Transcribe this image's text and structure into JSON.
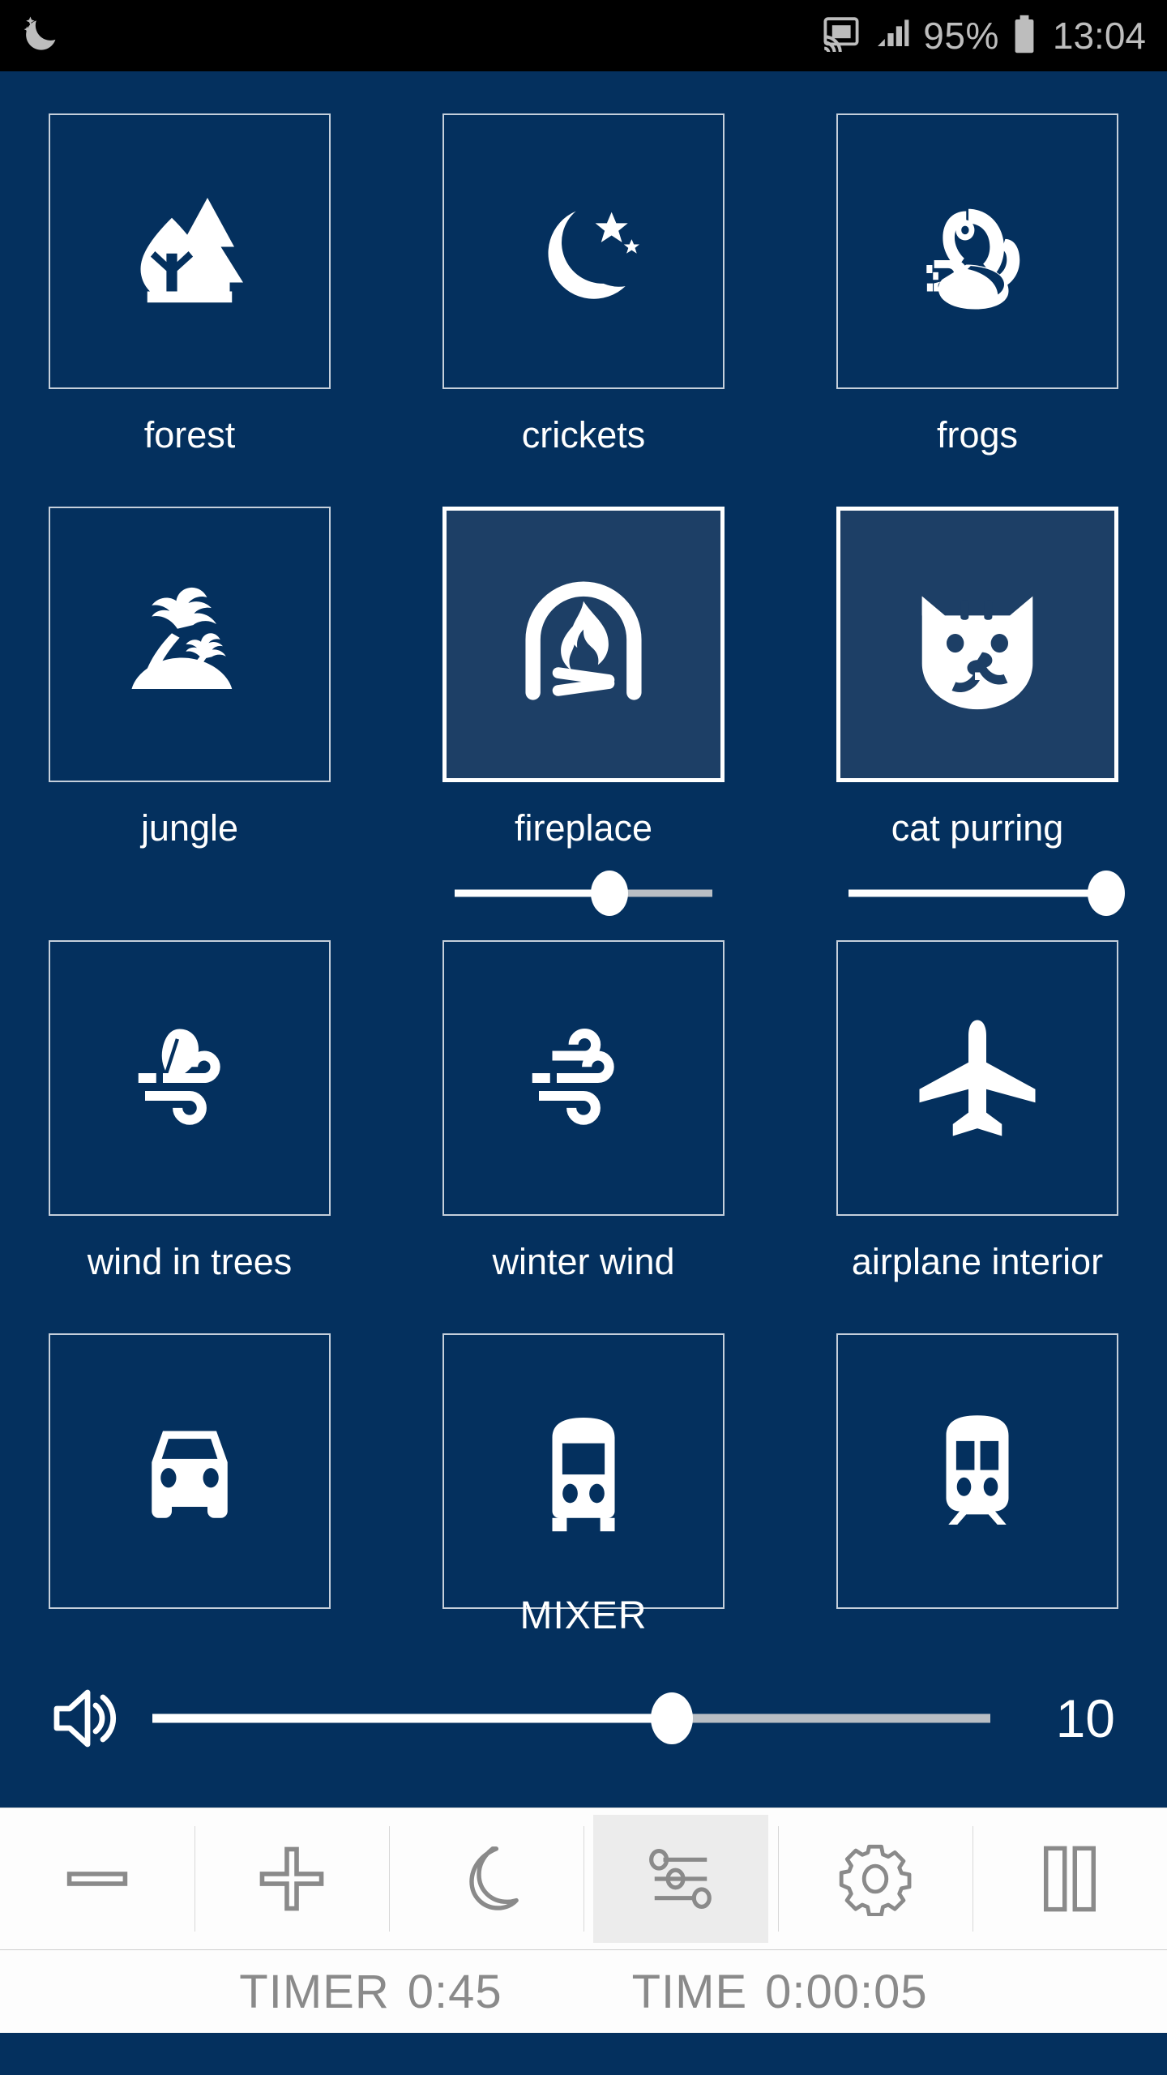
{
  "status_bar": {
    "dnd_icon": "crescent-moon-stars-icon",
    "cast_icon": "cast-screen-icon",
    "signal_icon": "signal-bars-icon",
    "battery_percent": "95%",
    "battery_icon": "battery-icon",
    "clock": "13:04"
  },
  "sounds": {
    "rows": [
      [
        {
          "label": "forest",
          "icon": "forest-trees-icon",
          "active": false,
          "volume": null
        },
        {
          "label": "crickets",
          "icon": "moon-stars-icon",
          "active": false,
          "volume": null
        },
        {
          "label": "frogs",
          "icon": "frog-icon",
          "active": false,
          "volume": null
        }
      ],
      [
        {
          "label": "jungle",
          "icon": "palm-island-icon",
          "active": false,
          "volume": null
        },
        {
          "label": "fireplace",
          "icon": "fireplace-icon",
          "active": true,
          "volume": 60
        },
        {
          "label": "cat purring",
          "icon": "cat-face-icon",
          "active": true,
          "volume": 100
        }
      ],
      [
        {
          "label": "wind in trees",
          "icon": "wind-leaf-icon",
          "active": false,
          "volume": null
        },
        {
          "label": "winter wind",
          "icon": "wind-icon",
          "active": false,
          "volume": null
        },
        {
          "label": "airplane interior",
          "icon": "airplane-icon",
          "active": false,
          "volume": null
        }
      ],
      [
        {
          "label": "",
          "icon": "car-icon",
          "active": false,
          "volume": null
        },
        {
          "label": "",
          "icon": "bus-icon",
          "active": false,
          "volume": null
        },
        {
          "label": "",
          "icon": "train-icon",
          "active": false,
          "volume": null
        }
      ]
    ]
  },
  "mixer": {
    "title": "MIXER",
    "master_volume_icon": "speaker-volume-icon",
    "master_volume_percent": 62,
    "master_volume_value": "10"
  },
  "toolbar": {
    "buttons": [
      {
        "name": "minus-button",
        "icon": "minus-icon",
        "active": false
      },
      {
        "name": "plus-button",
        "icon": "plus-icon",
        "active": false
      },
      {
        "name": "night-button",
        "icon": "crescent-moon-icon",
        "active": false
      },
      {
        "name": "mixer-button",
        "icon": "sliders-icon",
        "active": true
      },
      {
        "name": "settings-button",
        "icon": "gear-icon",
        "active": false
      },
      {
        "name": "pause-button",
        "icon": "pause-icon",
        "active": false
      }
    ]
  },
  "footer": {
    "timer_label": "TIMER",
    "timer_value": "0:45",
    "time_label": "TIME",
    "time_value": "0:00:05"
  },
  "colors": {
    "background": "#04305e",
    "tile_border": "#c5cfdb",
    "tile_active_bg": "#1d3f66",
    "accent_white": "#ffffff",
    "toolbar_bg": "#fdfdfd",
    "toolbar_icon": "#8a8a8a",
    "status_bar_bg": "#000000"
  }
}
